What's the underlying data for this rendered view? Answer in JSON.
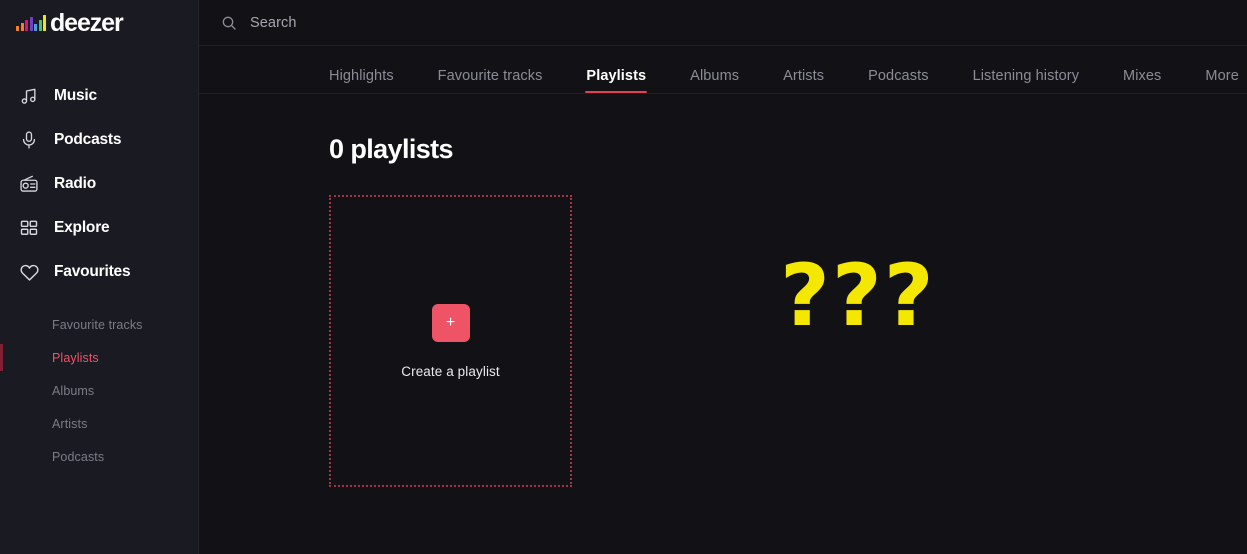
{
  "brand": {
    "name": "deezer",
    "logo_icon": "deezer-equalizer-logo",
    "logo_bars": [
      "#f58220",
      "#f58220",
      "#e5097f",
      "#6f42c1",
      "#4b9fd5",
      "#45c16a",
      "#f5e800"
    ]
  },
  "colors": {
    "sidebar_bg": "#191a22",
    "main_bg": "#121216",
    "accent_red": "#ef5466",
    "accent_underline": "#e4404f",
    "active_bar": "#7e2233",
    "dotted_border": "#a33347",
    "annotation_yellow": "#f5e800",
    "text_primary": "#ffffff",
    "text_muted": "#8b8c96"
  },
  "sidebar": {
    "items": [
      {
        "label": "Music",
        "icon": "music-note-icon"
      },
      {
        "label": "Podcasts",
        "icon": "microphone-icon"
      },
      {
        "label": "Radio",
        "icon": "radio-icon"
      },
      {
        "label": "Explore",
        "icon": "grid-icon"
      },
      {
        "label": "Favourites",
        "icon": "heart-icon"
      }
    ],
    "sub_items": [
      {
        "label": "Favourite tracks",
        "active": false
      },
      {
        "label": "Playlists",
        "active": true
      },
      {
        "label": "Albums",
        "active": false
      },
      {
        "label": "Artists",
        "active": false
      },
      {
        "label": "Podcasts",
        "active": false
      }
    ]
  },
  "search": {
    "icon": "search-icon",
    "placeholder": "Search",
    "value": ""
  },
  "tabs": [
    {
      "label": "Highlights",
      "active": false
    },
    {
      "label": "Favourite tracks",
      "active": false
    },
    {
      "label": "Playlists",
      "active": true
    },
    {
      "label": "Albums",
      "active": false
    },
    {
      "label": "Artists",
      "active": false
    },
    {
      "label": "Podcasts",
      "active": false
    },
    {
      "label": "Listening history",
      "active": false
    },
    {
      "label": "Mixes",
      "active": false
    },
    {
      "label": "More",
      "active": false,
      "chevron": "▼",
      "icon": "chevron-down-icon"
    }
  ],
  "main": {
    "page_title": "0 playlists",
    "create_card": {
      "plus_glyph": "+",
      "plus_icon": "plus-icon",
      "label": "Create a playlist"
    },
    "annotation": "???"
  }
}
